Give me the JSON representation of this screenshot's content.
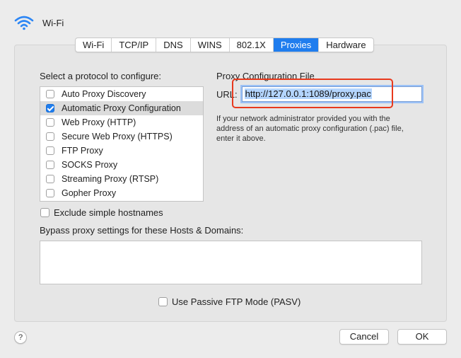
{
  "window": {
    "title": "Wi-Fi",
    "icon": "wifi-icon"
  },
  "tabs": [
    {
      "label": "Wi-Fi",
      "active": false
    },
    {
      "label": "TCP/IP",
      "active": false
    },
    {
      "label": "DNS",
      "active": false
    },
    {
      "label": "WINS",
      "active": false
    },
    {
      "label": "802.1X",
      "active": false
    },
    {
      "label": "Proxies",
      "active": true
    },
    {
      "label": "Hardware",
      "active": false
    }
  ],
  "protocols": {
    "label": "Select a protocol to configure:",
    "items": [
      {
        "label": "Auto Proxy Discovery",
        "checked": false,
        "selected": false
      },
      {
        "label": "Automatic Proxy Configuration",
        "checked": true,
        "selected": true
      },
      {
        "label": "Web Proxy (HTTP)",
        "checked": false,
        "selected": false
      },
      {
        "label": "Secure Web Proxy (HTTPS)",
        "checked": false,
        "selected": false
      },
      {
        "label": "FTP Proxy",
        "checked": false,
        "selected": false
      },
      {
        "label": "SOCKS Proxy",
        "checked": false,
        "selected": false
      },
      {
        "label": "Streaming Proxy (RTSP)",
        "checked": false,
        "selected": false
      },
      {
        "label": "Gopher Proxy",
        "checked": false,
        "selected": false
      }
    ]
  },
  "config": {
    "title": "Proxy Configuration File",
    "url_label": "URL:",
    "url_value": "http://127.0.0.1:1089/proxy.pac",
    "help_text": "If your network administrator provided you with the address of an automatic proxy configuration (.pac) file, enter it above."
  },
  "exclude_simple_hostnames": {
    "label": "Exclude simple hostnames",
    "checked": false
  },
  "bypass": {
    "label": "Bypass proxy settings for these Hosts & Domains:",
    "value": ""
  },
  "passive_ftp": {
    "label": "Use Passive FTP Mode (PASV)",
    "checked": false
  },
  "footer": {
    "help_label": "?",
    "cancel_label": "Cancel",
    "ok_label": "OK"
  },
  "colors": {
    "accent": "#1f7dee",
    "highlight_box": "#e8391d"
  }
}
